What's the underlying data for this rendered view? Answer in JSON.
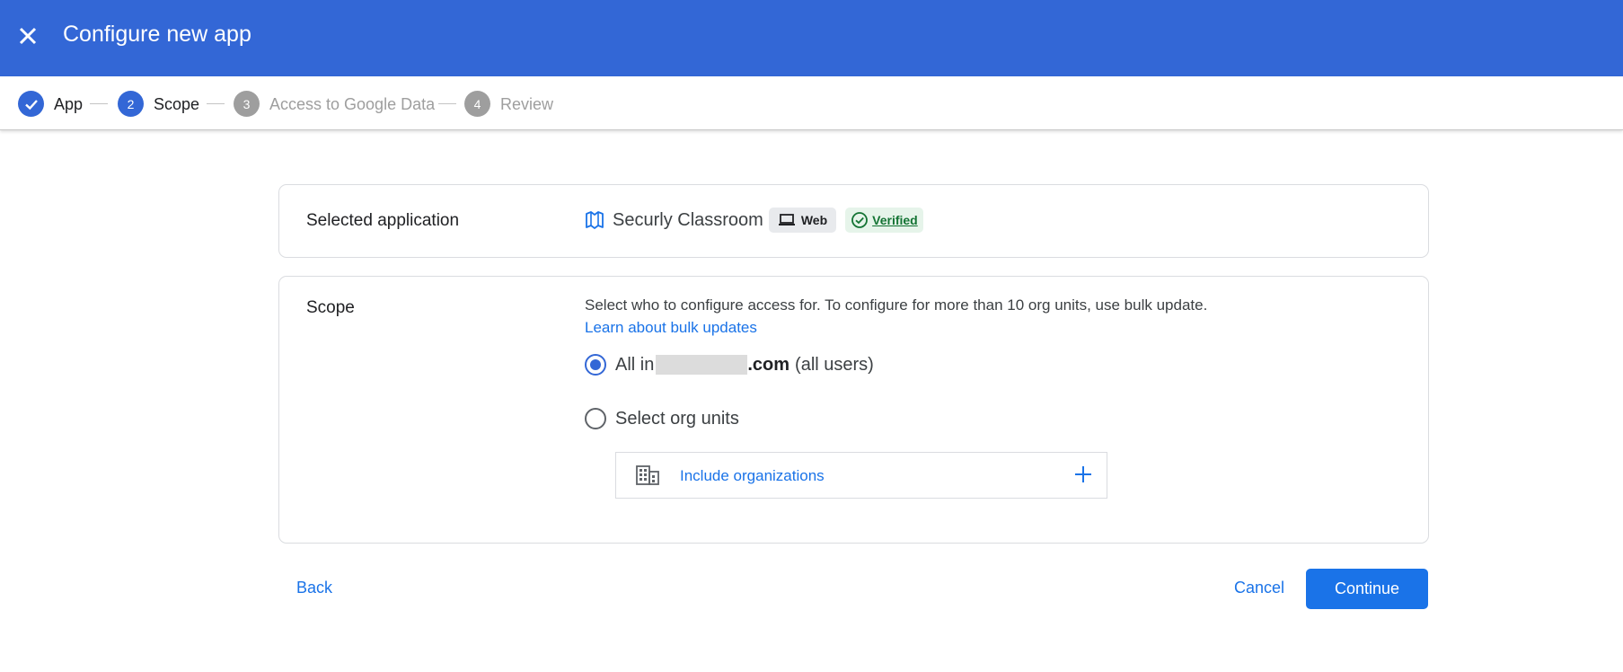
{
  "header": {
    "title": "Configure new app",
    "close_icon": "close-icon",
    "background_color": "#3367d6"
  },
  "stepper": {
    "steps": [
      {
        "number": "",
        "label": "App",
        "state": "completed",
        "icon": "check-icon"
      },
      {
        "number": "2",
        "label": "Scope",
        "state": "active"
      },
      {
        "number": "3",
        "label": "Access to Google Data",
        "state": "pending"
      },
      {
        "number": "4",
        "label": "Review",
        "state": "pending"
      }
    ]
  },
  "selected_application": {
    "label": "Selected application",
    "app_name": "Securly Classroom",
    "app_icon": "book-map-icon",
    "platform_chip": "Web",
    "platform_icon": "laptop-icon",
    "verified_chip": "Verified",
    "verified_icon": "check-circle-icon"
  },
  "scope": {
    "label": "Scope",
    "description": "Select who to configure access for. To configure for more than 10 org units, use bulk update.",
    "learn_link": "Learn about bulk updates",
    "options": {
      "all": {
        "prefix": "All in",
        "domain_suffix": ".com",
        "suffix": "(all users)",
        "checked": true
      },
      "select": {
        "label": "Select org units",
        "checked": false
      }
    },
    "include_organizations": {
      "label": "Include organizations",
      "icon": "building-icon",
      "action_icon": "plus-icon"
    }
  },
  "footer": {
    "back_label": "Back",
    "cancel_label": "Cancel",
    "continue_label": "Continue"
  },
  "colors": {
    "primary": "#3367d6",
    "link": "#1a73e8",
    "verified_green": "#137333",
    "pending_gray": "#9e9e9e"
  }
}
